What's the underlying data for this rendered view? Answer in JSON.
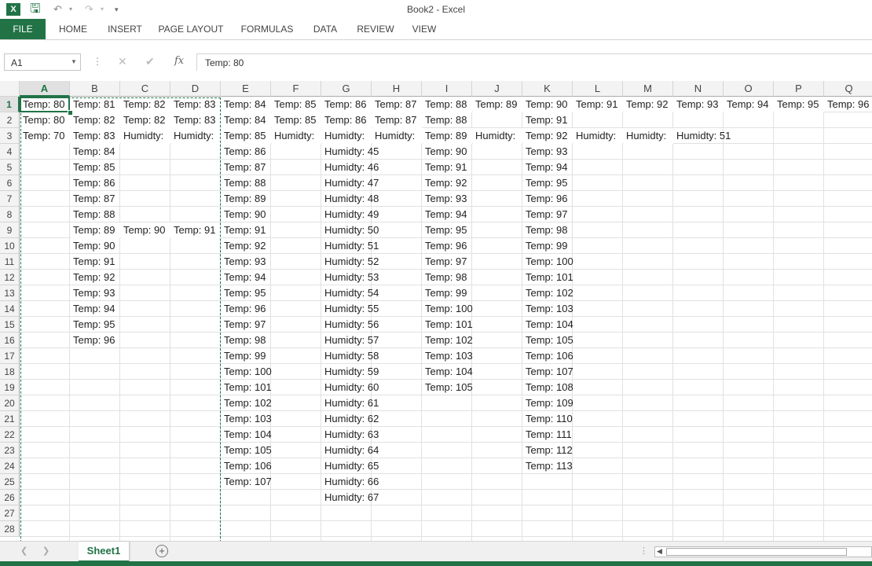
{
  "window": {
    "title": "Book2 - Excel"
  },
  "ribbon": {
    "tabs": [
      "FILE",
      "HOME",
      "INSERT",
      "PAGE LAYOUT",
      "FORMULAS",
      "DATA",
      "REVIEW",
      "VIEW"
    ]
  },
  "formula_bar": {
    "name_box": "A1",
    "formula": "Temp: 80"
  },
  "colors": {
    "accent": "#217346",
    "header_bg": "#f3f3f3",
    "gridline": "#e1e1e1"
  },
  "grid": {
    "columns": [
      "A",
      "B",
      "C",
      "D",
      "E",
      "F",
      "G",
      "H",
      "I",
      "J",
      "K",
      "L",
      "M",
      "N",
      "O",
      "P",
      "Q"
    ],
    "rows": 28,
    "active_cell": "A1",
    "copy_range": "A1:D28",
    "cells": {
      "A1": "Temp: 80",
      "B1": "Temp: 81",
      "C1": "Temp: 82",
      "D1": "Temp: 83",
      "E1": "Temp: 84",
      "F1": "Temp: 85",
      "G1": "Temp: 86",
      "H1": "Temp: 87",
      "I1": "Temp: 88",
      "J1": "Temp: 89",
      "K1": "Temp: 90",
      "L1": "Temp: 91",
      "M1": "Temp: 92",
      "N1": "Temp: 93",
      "O1": "Temp: 94",
      "P1": "Temp: 95",
      "Q1": "Temp: 96",
      "A2": "Temp: 80",
      "B2": "Temp: 82",
      "C2": "Temp: 82",
      "D2": "Temp: 83",
      "E2": "Temp: 84",
      "F2": "Temp: 85",
      "G2": "Temp: 86",
      "H2": "Temp: 87",
      "I2": "Temp: 88",
      "K2": "Temp: 91",
      "A3": "Temp: 70",
      "B3": "Temp: 83",
      "C3": "Humidty:",
      "D3": "Humidty:",
      "E3": "Temp: 85",
      "F3": "Humidty:",
      "G3": "Humidty:",
      "H3": "Humidty:",
      "I3": "Temp: 89",
      "J3": "Humidty:",
      "K3": "Temp: 92",
      "L3": "Humidty:",
      "M3": "Humidty:",
      "N3": "Humidty: 51",
      "B4": "Temp: 84",
      "E4": "Temp: 86",
      "G4": "Humidty: 45",
      "I4": "Temp: 90",
      "K4": "Temp: 93",
      "B5": "Temp: 85",
      "E5": "Temp: 87",
      "G5": "Humidty: 46",
      "I5": "Temp: 91",
      "K5": "Temp: 94",
      "B6": "Temp: 86",
      "E6": "Temp: 88",
      "G6": "Humidty: 47",
      "I6": "Temp: 92",
      "K6": "Temp: 95",
      "B7": "Temp: 87",
      "E7": "Temp: 89",
      "G7": "Humidty: 48",
      "I7": "Temp: 93",
      "K7": "Temp: 96",
      "B8": "Temp: 88",
      "E8": "Temp: 90",
      "G8": "Humidty: 49",
      "I8": "Temp: 94",
      "K8": "Temp: 97",
      "B9": "Temp: 89",
      "C9": "Temp: 90",
      "D9": "Temp: 91",
      "E9": "Temp: 91",
      "G9": "Humidty: 50",
      "I9": "Temp: 95",
      "K9": "Temp: 98",
      "B10": "Temp: 90",
      "E10": "Temp: 92",
      "G10": "Humidty: 51",
      "I10": "Temp: 96",
      "K10": "Temp: 99",
      "B11": "Temp: 91",
      "E11": "Temp: 93",
      "G11": "Humidty: 52",
      "I11": "Temp: 97",
      "K11": "Temp: 100",
      "B12": "Temp: 92",
      "E12": "Temp: 94",
      "G12": "Humidty: 53",
      "I12": "Temp: 98",
      "K12": "Temp: 101",
      "B13": "Temp: 93",
      "E13": "Temp: 95",
      "G13": "Humidty: 54",
      "I13": "Temp: 99",
      "K13": "Temp: 102",
      "B14": "Temp: 94",
      "E14": "Temp: 96",
      "G14": "Humidty: 55",
      "I14": "Temp: 100",
      "K14": "Temp: 103",
      "B15": "Temp: 95",
      "E15": "Temp: 97",
      "G15": "Humidty: 56",
      "I15": "Temp: 101",
      "K15": "Temp: 104",
      "B16": "Temp: 96",
      "E16": "Temp: 98",
      "G16": "Humidty: 57",
      "I16": "Temp: 102",
      "K16": "Temp: 105",
      "E17": "Temp: 99",
      "G17": "Humidty: 58",
      "I17": "Temp: 103",
      "K17": "Temp: 106",
      "E18": "Temp: 100",
      "G18": "Humidty: 59",
      "I18": "Temp: 104",
      "K18": "Temp: 107",
      "E19": "Temp: 101",
      "G19": "Humidty: 60",
      "I19": "Temp: 105",
      "K19": "Temp: 108",
      "E20": "Temp: 102",
      "G20": "Humidty: 61",
      "K20": "Temp: 109",
      "E21": "Temp: 103",
      "G21": "Humidty: 62",
      "K21": "Temp: 110",
      "E22": "Temp: 104",
      "G22": "Humidty: 63",
      "K22": "Temp: 111",
      "E23": "Temp: 105",
      "G23": "Humidty: 64",
      "K23": "Temp: 112",
      "E24": "Temp: 106",
      "G24": "Humidty: 65",
      "K24": "Temp: 113",
      "E25": "Temp: 107",
      "G25": "Humidty: 66",
      "G26": "Humidty: 67"
    }
  },
  "sheets": {
    "active": "Sheet1"
  },
  "icons": {
    "app": "excel-icon",
    "save": "save-icon",
    "undo": "undo-icon",
    "redo": "redo-icon",
    "add_sheet": "plus-circle-icon",
    "cancel": "close-icon",
    "enter": "check-icon",
    "function": "fx-icon"
  }
}
